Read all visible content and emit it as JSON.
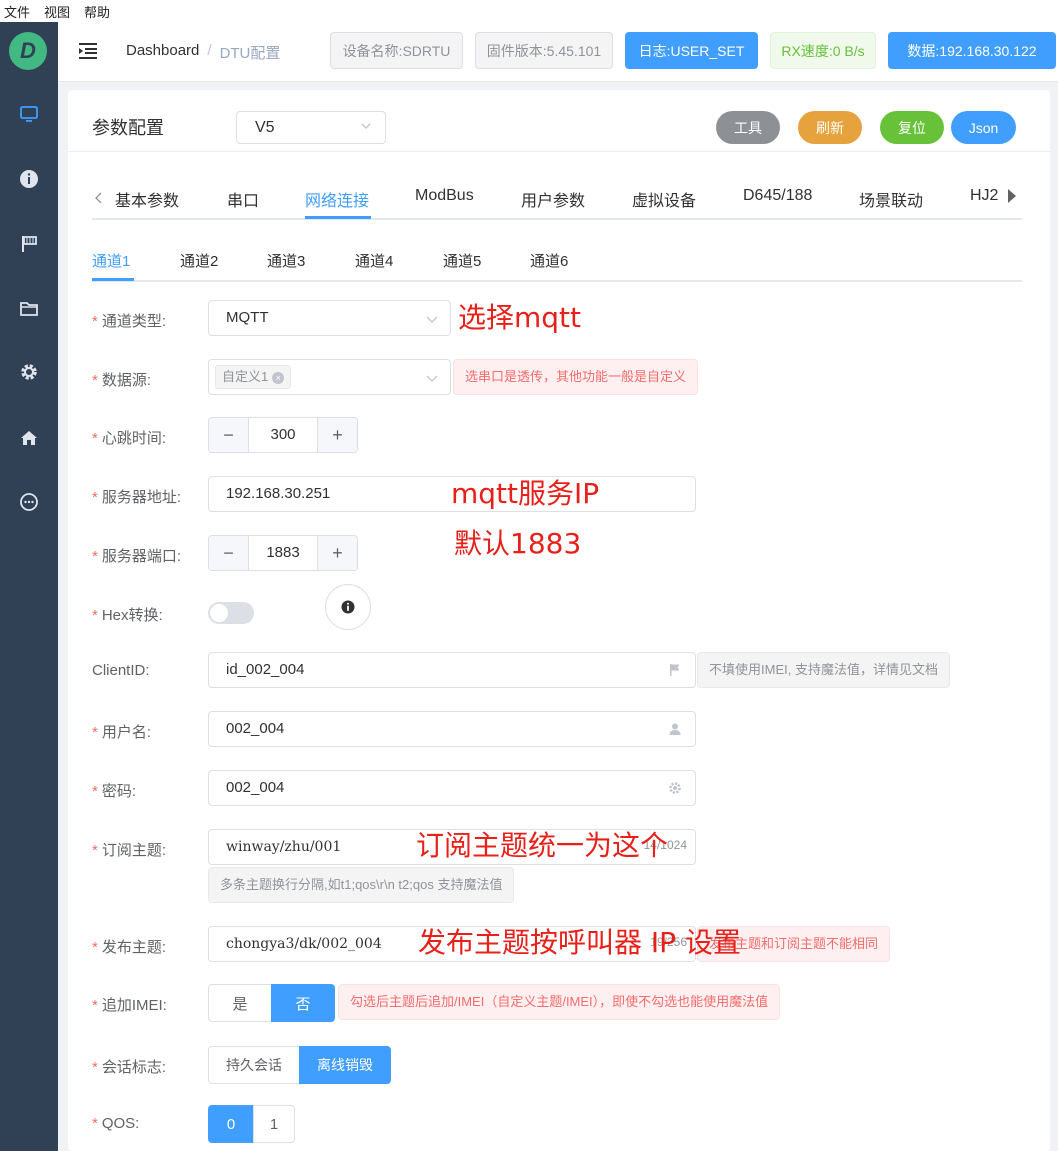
{
  "menubar": {
    "items": [
      "文件",
      "视图",
      "帮助"
    ]
  },
  "sidebar": {
    "logo_letter": "D",
    "icons": [
      "monitor-icon",
      "info-icon",
      "flag-icon",
      "folder-icon",
      "gear-icon",
      "home-icon",
      "chat-icon"
    ]
  },
  "header": {
    "breadcrumb_home": "Dashboard",
    "breadcrumb_sep": "/",
    "breadcrumb_current": "DTU配置",
    "tags": {
      "device_name": "设备名称:SDRTU",
      "firmware": "固件版本:5.45.101",
      "log": "日志:USER_SET",
      "rx_speed": "RX速度:0 B/s",
      "data": "数据:192.168.30.122"
    }
  },
  "panel": {
    "title": "参数配置",
    "version_select": "V5",
    "buttons": {
      "tools": "工具",
      "refresh": "刷新",
      "reset": "复位",
      "json": "Json"
    },
    "buttons_colors": {
      "tools": "#8d9095",
      "refresh": "#e6a23c",
      "reset": "#67c23a",
      "json": "#409eff"
    }
  },
  "tabs": {
    "main": [
      "基本参数",
      "串口",
      "网络连接",
      "ModBus",
      "用户参数",
      "虚拟设备",
      "D645/188",
      "场景联动",
      "HJ2"
    ],
    "main_active": "网络连接",
    "channels": [
      "通道1",
      "通道2",
      "通道3",
      "通道4",
      "通道5",
      "通道6"
    ],
    "channel_active": "通道1"
  },
  "form": {
    "required_mark": "*",
    "channel_type": {
      "label": "通道类型:",
      "value": "MQTT"
    },
    "data_source": {
      "label": "数据源:",
      "chip": "自定义1",
      "chip_close": "×",
      "hint": "选串口是透传，其他功能一般是自定义"
    },
    "heartbeat": {
      "label": "心跳时间:",
      "value": "300",
      "minus": "−",
      "plus": "+"
    },
    "server_addr": {
      "label": "服务器地址:",
      "value": "192.168.30.251"
    },
    "server_port": {
      "label": "服务器端口:",
      "value": "1883",
      "minus": "−",
      "plus": "+"
    },
    "hex": {
      "label": "Hex转换:"
    },
    "client_id": {
      "label": "ClientID:",
      "value": "id_002_004",
      "hint": "不填使用IMEI, 支持魔法值，详情见文档"
    },
    "username": {
      "label": "用户名:",
      "value": "002_004"
    },
    "password": {
      "label": "密码:",
      "value": "002_004"
    },
    "subscribe": {
      "label": "订阅主题:",
      "value": "winway/zhu/001",
      "counter": "14/1024",
      "hint": "多条主题换行分隔,如t1;qos\\r\\n t2;qos 支持魔法值"
    },
    "publish": {
      "label": "发布主题:",
      "value": "chongya3/dk/002_004",
      "counter": "19/256",
      "hint": "发布主题和订阅主题不能相同"
    },
    "append_imei": {
      "label": "追加IMEI:",
      "options": [
        "是",
        "否"
      ],
      "selected": "否",
      "hint": "勾选后主题后追加/IMEI（自定义主题/IMEI），即使不勾选也能使用魔法值"
    },
    "session": {
      "label": "会话标志:",
      "options": [
        "持久会话",
        "离线销毁"
      ],
      "selected": "离线销毁"
    },
    "qos": {
      "label": "QOS:",
      "options": [
        "0",
        "1"
      ],
      "selected": "0"
    }
  },
  "annotations": {
    "select_mqtt": "选择mqtt",
    "mqtt_ip": "mqtt服务IP",
    "default_port": "默认1883",
    "subscribe_note": "订阅主题统一为这个",
    "publish_note": "发布主题按呼叫器 IP 设置"
  }
}
